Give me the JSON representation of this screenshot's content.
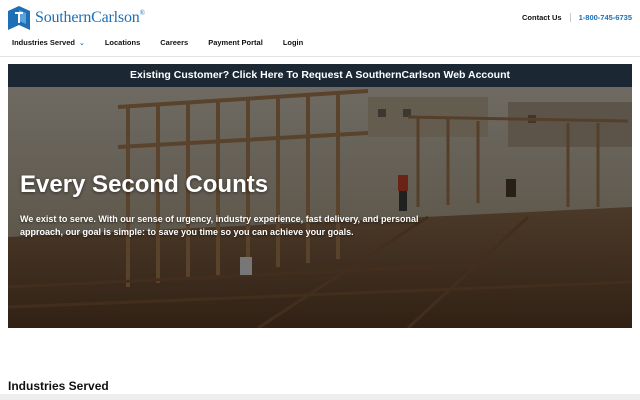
{
  "logo": {
    "name": "SouthernCarlson",
    "reg": "®"
  },
  "topbar": {
    "contact": "Contact Us",
    "phone": "1-800-745-6735"
  },
  "nav": {
    "items": [
      {
        "label": "Industries Served",
        "has_dropdown": true
      },
      {
        "label": "Locations"
      },
      {
        "label": "Careers"
      },
      {
        "label": "Payment Portal"
      },
      {
        "label": "Login"
      }
    ]
  },
  "banner": {
    "text": "Existing Customer? Click Here To Request A SouthernCarlson Web Account"
  },
  "hero": {
    "title": "Every Second Counts",
    "text": "We exist to serve. With our sense of urgency, industry experience, fast delivery, and personal approach, our goal is simple: to save you time so you can achieve your goals."
  },
  "section": {
    "title": "Industries Served"
  },
  "colors": {
    "brand_blue": "#1e6fb5",
    "banner_bg": "#1b2733"
  },
  "icons": {
    "logo": "shield-logo-icon",
    "dropdown": "chevron-down-icon"
  }
}
